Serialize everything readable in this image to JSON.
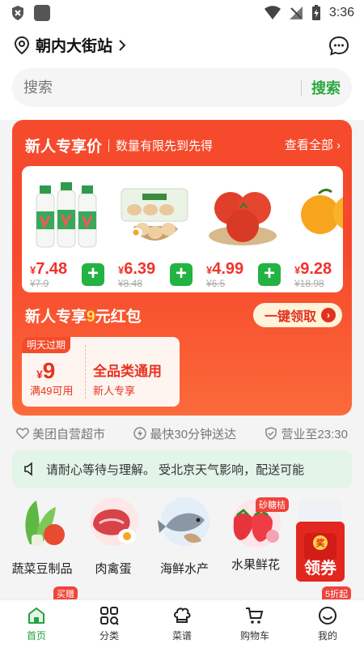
{
  "status_bar": {
    "time": "3:36"
  },
  "header": {
    "location": "朝内大街站",
    "search_placeholder": "搜索",
    "search_button": "搜索"
  },
  "promo": {
    "title": "新人专享价",
    "subtitle": "数量有限先到先得",
    "view_all": "查看全部",
    "products": [
      {
        "name": "milk-drink",
        "currency": "¥",
        "price": "7.48",
        "old_price": "¥7.9"
      },
      {
        "name": "eggs",
        "currency": "¥",
        "price": "6.39",
        "old_price": "¥8.48"
      },
      {
        "name": "tomatoes",
        "currency": "¥",
        "price": "4.99",
        "old_price": "¥6.5"
      },
      {
        "name": "oranges",
        "currency": "¥",
        "price": "9.28",
        "old_price": "¥18.98"
      }
    ],
    "redpack_prefix": "新人专享",
    "redpack_amount": "9",
    "redpack_suffix": "元红包",
    "grab_button": "一键领取",
    "coupon": {
      "tag": "明天过期",
      "currency": "¥",
      "amount": "9",
      "condition": "满49可用",
      "name": "全品类通用",
      "desc": "新人专享"
    }
  },
  "features": [
    "美团自营超市",
    "最快30分钟送达",
    "营业至23:30"
  ],
  "notice": "请耐心等待与理解。     受北京天气影响，配送可能",
  "categories": [
    {
      "label": "蔬菜豆制品",
      "badge": ""
    },
    {
      "label": "肉禽蛋",
      "badge": ""
    },
    {
      "label": "海鲜水产",
      "badge": ""
    },
    {
      "label": "水果鲜花",
      "badge": "砂糖桔"
    }
  ],
  "coupon_float": {
    "top": "奖",
    "text": "领券"
  },
  "row2_badges": [
    "买赠",
    "5折起"
  ],
  "tabs": [
    {
      "label": "首页",
      "icon": "home-icon",
      "active": true
    },
    {
      "label": "分类",
      "icon": "category-icon",
      "active": false
    },
    {
      "label": "菜谱",
      "icon": "chef-hat-icon",
      "active": false
    },
    {
      "label": "购物车",
      "icon": "cart-icon",
      "active": false
    },
    {
      "label": "我的",
      "icon": "smiley-icon",
      "active": false
    }
  ],
  "colors": {
    "accent_green": "#22b342",
    "promo_red": "#f64a2c",
    "price_red": "#f0322a"
  }
}
